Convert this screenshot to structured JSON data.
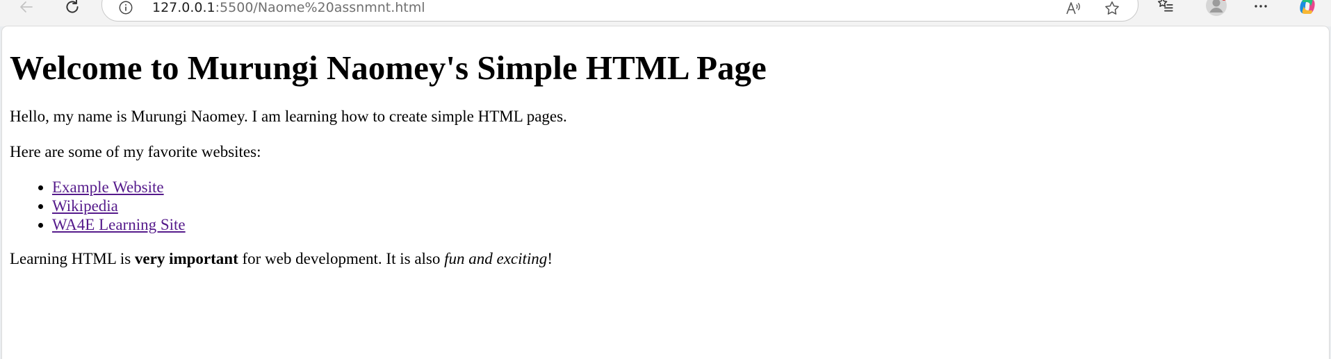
{
  "browser": {
    "url_host": "127.0.0.1",
    "url_path": ":5500/Naome%20assnmnt.html",
    "icons": {
      "back": "back-arrow-icon",
      "reload": "reload-icon",
      "site_info": "info-icon",
      "read_aloud": "read-aloud-icon",
      "favorite": "star-icon",
      "favorites": "favorites-list-icon",
      "profile": "profile-avatar-icon",
      "more": "more-dots-icon",
      "copilot": "copilot-icon"
    }
  },
  "page": {
    "heading": "Welcome to Murungi Naomey's Simple HTML Page",
    "intro": "Hello, my name is Murungi Naomey. I am learning how to create simple HTML pages.",
    "favorites_intro": "Here are some of my favorite websites:",
    "links": [
      {
        "label": "Example Website"
      },
      {
        "label": "Wikipedia"
      },
      {
        "label": "WA4E Learning Site"
      }
    ],
    "closing": {
      "part1": "Learning HTML is ",
      "bold": "very important",
      "part2": " for web development. It is also ",
      "italic": "fun and exciting",
      "part3": "!"
    }
  },
  "colors": {
    "visited_link": "#551a8b",
    "toolbar_bg": "#f3f3f3"
  }
}
